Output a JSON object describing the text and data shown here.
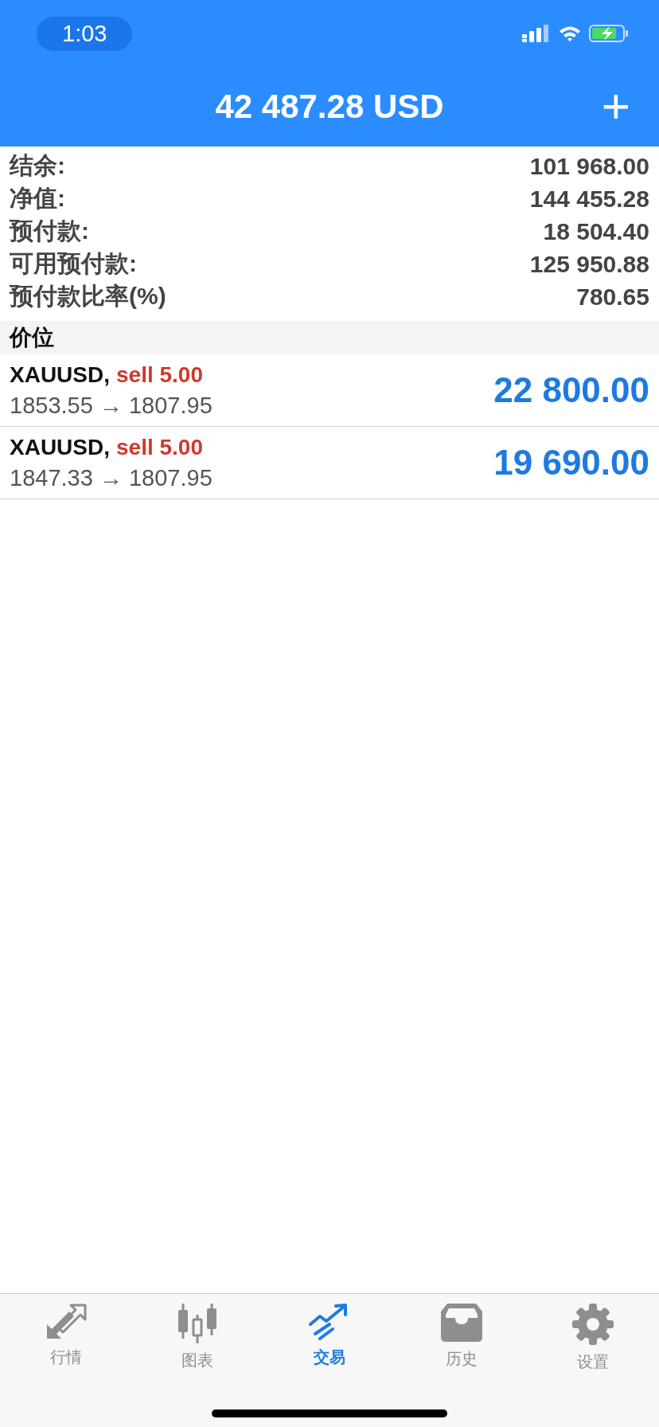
{
  "status_bar": {
    "time": "1:03"
  },
  "header": {
    "title": "42 487.28 USD",
    "add_button": "+"
  },
  "summary": [
    {
      "label": "结余:",
      "value": "101 968.00"
    },
    {
      "label": "净值:",
      "value": "144 455.28"
    },
    {
      "label": "预付款:",
      "value": "18 504.40"
    },
    {
      "label": "可用预付款:",
      "value": "125 950.88"
    },
    {
      "label": "预付款比率(%)",
      "value": "780.65"
    }
  ],
  "section_title": "价位",
  "positions": [
    {
      "symbol": "XAUUSD,",
      "kind": "sell",
      "order": "sell 5.00",
      "prices": "1853.55 → 1807.95",
      "profit": "22 800.00"
    },
    {
      "symbol": "XAUUSD,",
      "kind": "sell",
      "order": "sell 5.00",
      "prices": "1847.33 → 1807.95",
      "profit": "19 690.00"
    }
  ],
  "tabs": [
    {
      "label": "行情",
      "kind": "quotes",
      "selected": false
    },
    {
      "label": "图表",
      "kind": "chart",
      "selected": false
    },
    {
      "label": "交易",
      "kind": "trade",
      "selected": true
    },
    {
      "label": "历史",
      "kind": "history",
      "selected": false
    },
    {
      "label": "设置",
      "kind": "settings",
      "selected": false
    }
  ]
}
